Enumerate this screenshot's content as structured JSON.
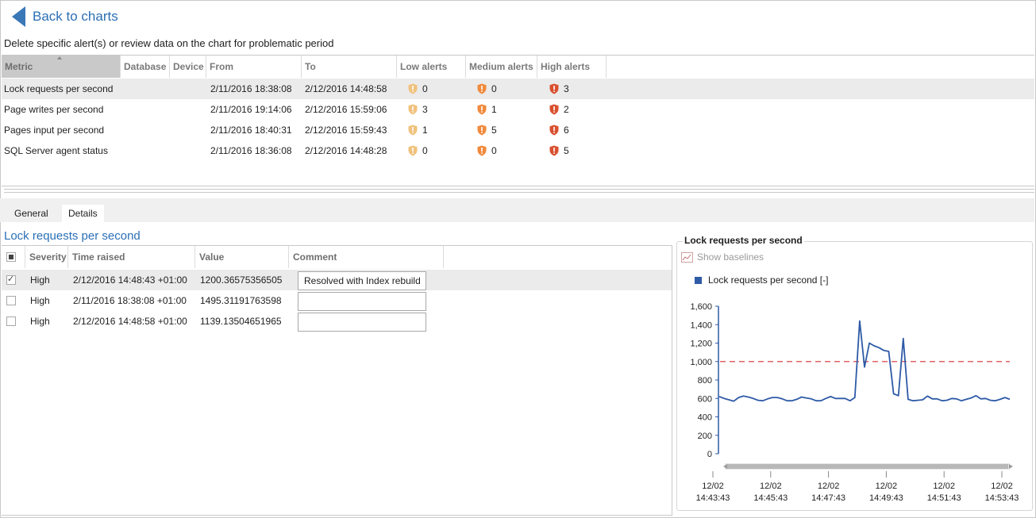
{
  "nav": {
    "back_label": "Back to charts"
  },
  "instructions": "Delete specific alert(s) or review data on the chart for problematic period",
  "alerts_grid": {
    "columns": [
      "Metric",
      "Database",
      "Device",
      "From",
      "To",
      "Low alerts",
      "Medium alerts",
      "High alerts"
    ],
    "sorted_column": "Metric",
    "rows": [
      {
        "metric": "Lock requests per second",
        "database": "",
        "device": "",
        "from": "2/11/2016 18:38:08",
        "to": "2/12/2016 14:48:58",
        "low": "0",
        "medium": "0",
        "high": "3",
        "selected": true
      },
      {
        "metric": "Page writes per second",
        "database": "",
        "device": "",
        "from": "2/11/2016 19:14:06",
        "to": "2/12/2016 15:59:06",
        "low": "3",
        "medium": "1",
        "high": "2",
        "selected": false
      },
      {
        "metric": "Pages input per second",
        "database": "",
        "device": "",
        "from": "2/11/2016 18:40:31",
        "to": "2/12/2016 15:59:43",
        "low": "1",
        "medium": "5",
        "high": "6",
        "selected": false
      },
      {
        "metric": "SQL Server agent status",
        "database": "",
        "device": "",
        "from": "2/11/2016 18:36:08",
        "to": "2/12/2016 14:48:28",
        "low": "0",
        "medium": "0",
        "high": "5",
        "selected": false
      }
    ]
  },
  "tabs": [
    {
      "label": "General",
      "active": false
    },
    {
      "label": "Details",
      "active": true
    }
  ],
  "details": {
    "title": "Lock requests per second",
    "columns": [
      "Severity",
      "Time raised",
      "Value",
      "Comment"
    ],
    "rows": [
      {
        "checked": true,
        "severity": "High",
        "time_raised": "2/12/2016 14:48:43 +01:00",
        "value": "1200.36575356505",
        "comment": "Resolved with Index rebuild"
      },
      {
        "checked": false,
        "severity": "High",
        "time_raised": "2/11/2016 18:38:08 +01:00",
        "value": "1495.31191763598",
        "comment": ""
      },
      {
        "checked": false,
        "severity": "High",
        "time_raised": "2/12/2016 14:48:58 +01:00",
        "value": "1139.13504651965",
        "comment": ""
      }
    ]
  },
  "chart_panel": {
    "title": "Lock requests per second",
    "show_baselines_label": "Show baselines",
    "legend_label": "Lock requests per second [-]"
  },
  "colors": {
    "accent": "#2b6fb5",
    "series": "#2e5aa6",
    "threshold": "#e06464",
    "low_alert": "#f1c27d",
    "medium_alert": "#f08a3c",
    "high_alert": "#d9502f"
  },
  "icons": {
    "back": "back-arrow-icon",
    "low": "shield-low-icon",
    "medium": "shield-medium-icon",
    "high": "shield-high-icon",
    "baselines": "baseline-chart-icon"
  },
  "chart_data": {
    "type": "line",
    "title": "Lock requests per second",
    "series": [
      {
        "name": "Lock requests per second [-]",
        "values": [
          620,
          600,
          585,
          570,
          610,
          625,
          615,
          600,
          580,
          575,
          595,
          610,
          610,
          595,
          575,
          575,
          590,
          615,
          605,
          595,
          575,
          575,
          600,
          620,
          600,
          600,
          600,
          575,
          610,
          1440,
          940,
          1200,
          1170,
          1150,
          1120,
          1110,
          650,
          630,
          1250,
          590,
          575,
          580,
          585,
          625,
          595,
          595,
          575,
          580,
          600,
          595,
          575,
          590,
          605,
          630,
          595,
          600,
          580,
          575,
          590,
          610,
          590
        ]
      }
    ],
    "threshold": 1000,
    "x_tick_labels": [
      [
        "12/02",
        "14:43:43"
      ],
      [
        "12/02",
        "14:45:43"
      ],
      [
        "12/02",
        "14:47:43"
      ],
      [
        "12/02",
        "14:49:43"
      ],
      [
        "12/02",
        "14:51:43"
      ],
      [
        "12/02",
        "14:53:43"
      ]
    ],
    "y_ticks": [
      "0",
      "200",
      "400",
      "600",
      "800",
      "1,000",
      "1,200",
      "1,400",
      "1,600"
    ],
    "ylim": [
      0,
      1600
    ],
    "grid": false,
    "legend_position": "top-left"
  }
}
